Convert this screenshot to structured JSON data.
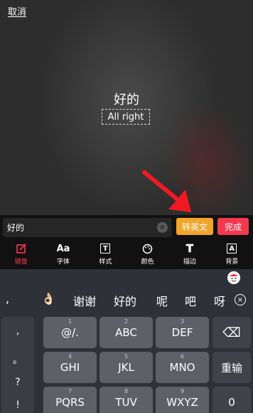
{
  "header": {
    "cancel_label": "取消"
  },
  "preview": {
    "main_text": "好的",
    "translated_text": "All right"
  },
  "input": {
    "value": "好的",
    "clear_icon": "×"
  },
  "actions": {
    "to_english_label": "转英文",
    "done_label": "完成"
  },
  "tools": [
    {
      "label": "键盘",
      "icon": "keyboard-edit-icon",
      "active": true
    },
    {
      "label": "字体",
      "icon": "Aa",
      "active": false
    },
    {
      "label": "样式",
      "icon": "T",
      "active": false
    },
    {
      "label": "颜色",
      "icon": "palette-icon",
      "active": false
    },
    {
      "label": "描边",
      "icon": "T",
      "active": false
    },
    {
      "label": "背景",
      "icon": "A",
      "active": false
    }
  ],
  "candidates": [
    ",",
    "👌🏻",
    "谢谢",
    "好的",
    "呢",
    "吧",
    "呀"
  ],
  "candidate_clear_icon": "×",
  "punctuation": [
    ",",
    "。",
    "?",
    "!"
  ],
  "keys": [
    {
      "main": "@/.",
      "num": "1"
    },
    {
      "main": "ABC",
      "num": "2"
    },
    {
      "main": "DEF",
      "num": "3"
    },
    {
      "main": "GHI",
      "num": "4"
    },
    {
      "main": "JKL",
      "num": "5"
    },
    {
      "main": "MNO",
      "num": "6"
    },
    {
      "main": "PQRS",
      "num": "7"
    },
    {
      "main": "TUV",
      "num": "8"
    },
    {
      "main": "WXYZ",
      "num": "9"
    }
  ],
  "func_keys": {
    "backspace_icon": "⌫",
    "retype_label": "重输",
    "zero_label": "0"
  },
  "colors": {
    "accent_red": "#f4384d",
    "accent_orange": "#f2a52b",
    "arrow_red": "#ee1a23"
  }
}
